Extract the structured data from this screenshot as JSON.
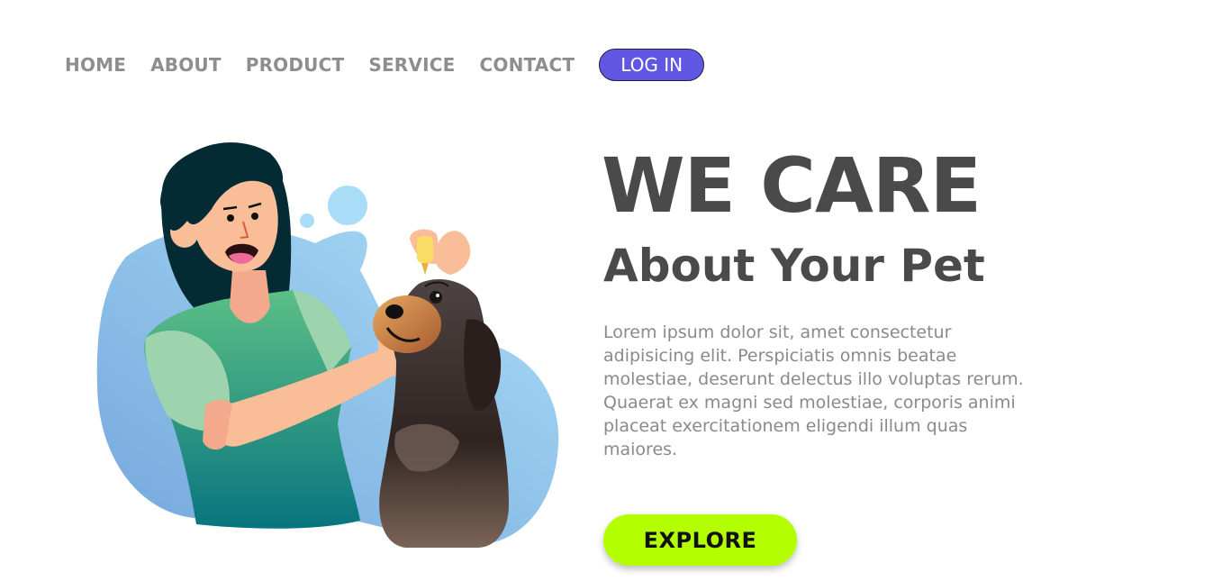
{
  "nav": {
    "items": [
      {
        "label": "HOME"
      },
      {
        "label": "ABOUT"
      },
      {
        "label": "PRODUCT"
      },
      {
        "label": "SERVICE"
      },
      {
        "label": "CONTACT"
      }
    ],
    "login_label": "LOG IN"
  },
  "hero": {
    "title": "WE CARE",
    "subtitle": "About Your Pet",
    "body": "Lorem ipsum dolor sit, amet consectetur adipisicing elit. Perspiciatis omnis beatae molestiae, deserunt delectus illo voluptas rerum. Quaerat ex magni sed molestiae, corporis animi placeat exercitationem eligendi illum quas maiores.",
    "cta_label": "EXPLORE"
  },
  "colors": {
    "accent": "#6257e3",
    "cta": "#b3ff00",
    "heading": "#4a4a4a",
    "nav_text": "#8e8e8e",
    "body_text": "#8a8a8a"
  }
}
